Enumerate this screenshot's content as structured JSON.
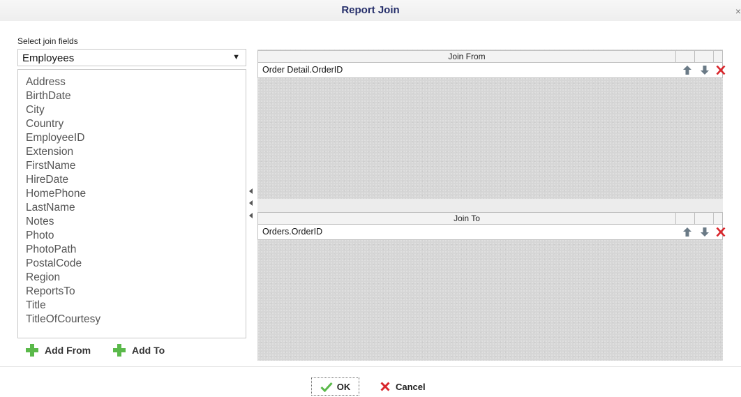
{
  "dialog": {
    "title": "Report Join",
    "close_glyph": "×"
  },
  "left": {
    "section_label": "Select join fields",
    "table_select": {
      "value": "Employees",
      "arrow": "▼"
    },
    "fields": [
      "Address",
      "BirthDate",
      "City",
      "Country",
      "EmployeeID",
      "Extension",
      "FirstName",
      "HireDate",
      "HomePhone",
      "LastName",
      "Notes",
      "Photo",
      "PhotoPath",
      "PostalCode",
      "Region",
      "ReportsTo",
      "Title",
      "TitleOfCourtesy"
    ],
    "add_from_label": "Add From",
    "add_to_label": "Add To"
  },
  "join_from": {
    "header": "Join From",
    "rows": [
      {
        "field": "Order Detail.OrderID"
      }
    ]
  },
  "join_to": {
    "header": "Join To",
    "rows": [
      {
        "field": "Orders.OrderID"
      }
    ]
  },
  "footer": {
    "ok_label": "OK",
    "cancel_label": "Cancel"
  },
  "icons": {
    "add": "plus-icon",
    "up": "arrow-up-icon",
    "down": "arrow-down-icon",
    "delete": "delete-x-icon",
    "ok": "check-icon",
    "cancel": "cancel-x-icon"
  },
  "colors": {
    "title": "#27306b",
    "green": "#5ab94a",
    "red": "#d9262c",
    "icon_gray": "#6a7a86",
    "panel_bg": "#d6d6d6"
  }
}
